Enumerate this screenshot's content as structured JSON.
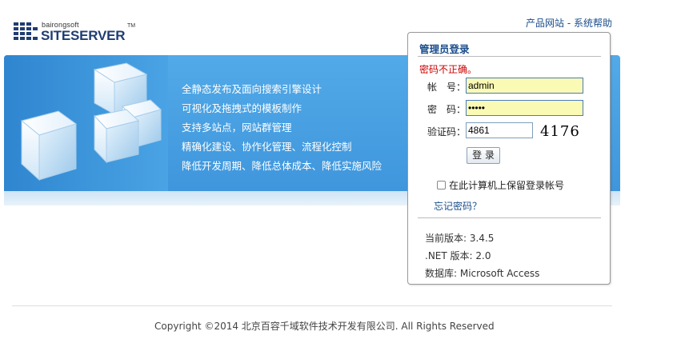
{
  "logo": {
    "small": "bairongsoft",
    "big": "SITESERVER",
    "tm": "TM"
  },
  "top_links": {
    "product": "产品网站",
    "separator": " - ",
    "help": "系统帮助"
  },
  "features": [
    "全静态发布及面向搜索引擎设计",
    "可视化及拖拽式的模板制作",
    "支持多站点，网站群管理",
    "精确化建设、协作化管理、流程化控制",
    "降低开发周期、降低总体成本、降低实施风险"
  ],
  "login": {
    "title": "管理员登录",
    "error": "密码不正确。",
    "username_label": "帐　号：",
    "username_value": "admin",
    "password_label": "密　码：",
    "password_value": "•••••",
    "captcha_label": "验证码：",
    "captcha_value": "4861",
    "captcha_image_text": "4176",
    "submit": "登 录",
    "remember": "在此计算机上保留登录帐号",
    "forgot": "忘记密码？"
  },
  "info": {
    "version": "当前版本: 3.4.5",
    "dotnet": ".NET 版本: 2.0",
    "database": "数据库: Microsoft Access"
  },
  "footer": "Copyright ©2014 北京百容千域软件技术开发有限公司. All Rights Reserved"
}
